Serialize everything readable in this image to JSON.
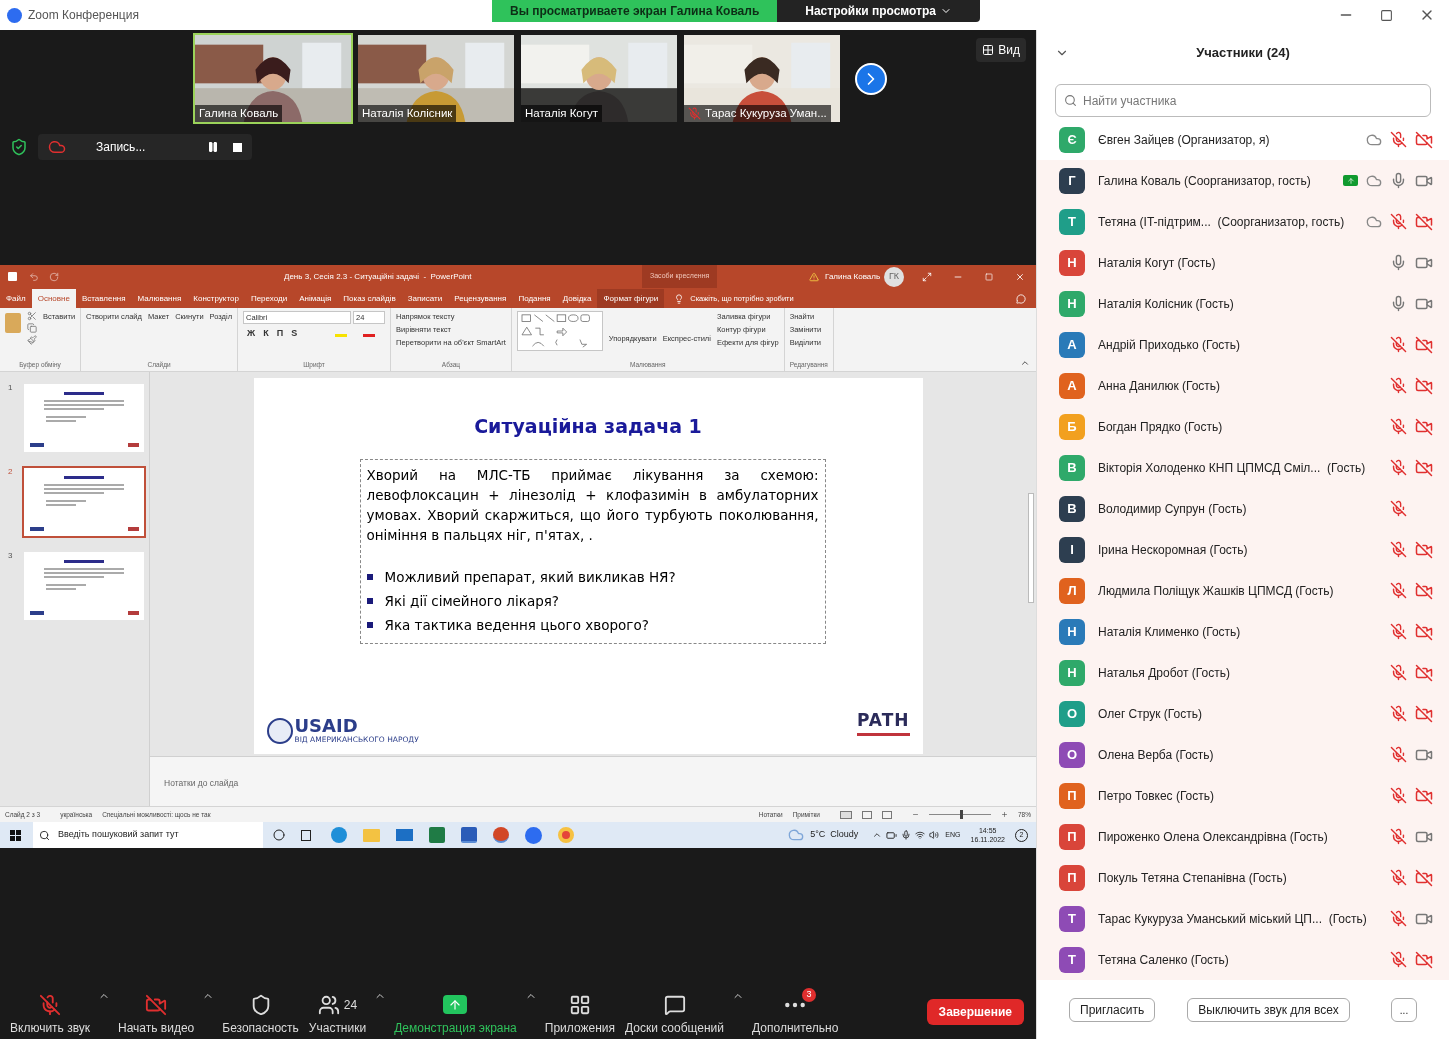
{
  "window": {
    "title": "Zoom Конференция"
  },
  "share_banner": {
    "text": "Вы просматриваете экран Галина Коваль",
    "menu": "Настройки просмотра"
  },
  "videos": [
    {
      "name": "Галина Коваль",
      "muted": false,
      "selected": true
    },
    {
      "name": "Наталія Колісник",
      "muted": false,
      "selected": false
    },
    {
      "name": "Наталія Когут",
      "muted": false,
      "selected": false
    },
    {
      "name": "Тарас Кукуруза Уман...",
      "muted": true,
      "selected": false
    }
  ],
  "view_button": "Вид",
  "recording": {
    "label": "Запись..."
  },
  "powerpoint": {
    "title": "День 3, Сесія 2.3 - Ситуаційні задачі  -  PowerPoint",
    "context_label": "Засоби креслення",
    "user": "Галина Коваль",
    "user_initials": "ГК",
    "tabs": [
      {
        "label": "Файл",
        "selected": false
      },
      {
        "label": "Основне",
        "selected": true
      },
      {
        "label": "Вставлення",
        "selected": false
      },
      {
        "label": "Малювання",
        "selected": false
      },
      {
        "label": "Конструктор",
        "selected": false
      },
      {
        "label": "Переходи",
        "selected": false
      },
      {
        "label": "Анімація",
        "selected": false
      },
      {
        "label": "Показ слайдів",
        "selected": false
      },
      {
        "label": "Записати",
        "selected": false
      },
      {
        "label": "Рецензування",
        "selected": false
      },
      {
        "label": "Подання",
        "selected": false
      },
      {
        "label": "Довідка",
        "selected": false
      },
      {
        "label": "Формат фігури",
        "selected": false
      }
    ],
    "tell_me": "Скажіть, що потрібно зробити",
    "ribbon": [
      {
        "label": "Буфер обміну",
        "items": [
          "Вставити"
        ]
      },
      {
        "label": "Слайди",
        "items": [
          "Створити слайд",
          "Макет",
          "Скинути",
          "Розділ"
        ]
      },
      {
        "label": "Шрифт",
        "font": "Calibri",
        "size": "24",
        "items": [
          "Ж",
          "К",
          "П",
          "S"
        ]
      },
      {
        "label": "Абзац",
        "items": [
          "Напрямок тексту",
          "Вирівняти текст",
          "Перетворити на об'єкт SmartArt"
        ]
      },
      {
        "label": "Малювання",
        "items": [
          "Упорядкувати",
          "Експрес-стилі",
          "Заливка фігури",
          "Контур фігури",
          "Ефекти для фігур"
        ]
      },
      {
        "label": "Редагування",
        "items": [
          "Знайти",
          "Замінити",
          "Виділити"
        ]
      }
    ],
    "thumbnails": [
      {
        "number": "1",
        "selected": false
      },
      {
        "number": "2",
        "selected": true
      },
      {
        "number": "3",
        "selected": false
      }
    ],
    "slide": {
      "title": "Ситуаційна задача 1",
      "paragraph": "Хворий на МЛС-ТБ приймає лікування за схемою: левофлоксацин + лінезолід + клофазимін в амбулаторних умовах.  Хворий скаржиться, що його турбують поколювання, оніміння в пальцях ніг, п'ятах, .",
      "bullets": [
        "Можливий препарат, який викликав НЯ?",
        "Які дії сімейного лікаря?",
        "Яка тактика ведення цього хворого?"
      ],
      "logo_left": "USAID",
      "logo_left_sub": "ВІД АМЕРИКАНСЬКОГО НАРОДУ",
      "logo_right": "PATH"
    },
    "notes_placeholder": "Нотатки до слайда",
    "status_bar": {
      "slide": "Слайд 2 з 3",
      "language": "українська",
      "accessibility": "Спеціальні можливості: щось не так",
      "notes": "Нотатки",
      "comments": "Примітки",
      "zoom": "78%",
      "level": 0.5
    }
  },
  "taskbar": {
    "search_placeholder": "Введіть пошуковий запит тут",
    "weather": "5°C  Cloudy",
    "language": "ENG",
    "time": "14:55",
    "date": "16.11.2022",
    "notifications": "2"
  },
  "toolbar": [
    {
      "kind": "mic",
      "label": "Включить звук"
    },
    {
      "kind": "video",
      "label": "Начать видео"
    },
    {
      "kind": "security",
      "label": "Безопасность"
    },
    {
      "kind": "participants",
      "label": "Участники",
      "count": "24"
    },
    {
      "kind": "share",
      "label": "Демонстрация экрана"
    },
    {
      "kind": "apps",
      "label": "Приложения"
    },
    {
      "kind": "whiteboard",
      "label": "Доски сообщений"
    },
    {
      "kind": "more",
      "label": "Дополнительно",
      "badge": "3"
    }
  ],
  "end_button": "Завершение",
  "participants_panel": {
    "title": "Участники (24)",
    "search_placeholder": "Найти участника",
    "participants": [
      {
        "initial": "Є",
        "name": "Євген Зайцев (Организатор, я)",
        "color": "#2fa96a",
        "highlighted": false,
        "sharing": false,
        "recording": true,
        "mic_muted": true,
        "has_camera": true,
        "video_off": true
      },
      {
        "initial": "Г",
        "name": "Галина Коваль (Соорганизатор, гость)",
        "color": "#2d3e50",
        "highlighted": true,
        "sharing": true,
        "recording": true,
        "mic_muted": false,
        "has_camera": true,
        "video_off": false
      },
      {
        "initial": "Т",
        "name": "Тетяна (IT-підтрим...  (Соорганизатор, гость)",
        "color": "#1f9e89",
        "highlighted": true,
        "sharing": false,
        "recording": true,
        "mic_muted": true,
        "has_camera": true,
        "video_off": true
      },
      {
        "initial": "Н",
        "name": "Наталія Когут (Гость)",
        "color": "#d9453a",
        "highlighted": true,
        "sharing": false,
        "recording": false,
        "mic_muted": false,
        "has_camera": true,
        "video_off": false
      },
      {
        "initial": "Н",
        "name": "Наталія Колісник (Гость)",
        "color": "#2fa96a",
        "highlighted": true,
        "sharing": false,
        "recording": false,
        "mic_muted": false,
        "has_camera": true,
        "video_off": false
      },
      {
        "initial": "А",
        "name": "Андрій Приходько (Гость)",
        "color": "#2a7ab8",
        "highlighted": true,
        "sharing": false,
        "recording": false,
        "mic_muted": true,
        "has_camera": true,
        "video_off": true
      },
      {
        "initial": "А",
        "name": "Анна Данилюк (Гость)",
        "color": "#e0621e",
        "highlighted": true,
        "sharing": false,
        "recording": false,
        "mic_muted": true,
        "has_camera": true,
        "video_off": true
      },
      {
        "initial": "Б",
        "name": "Богдан Прядко (Гость)",
        "color": "#f2a01f",
        "highlighted": true,
        "sharing": false,
        "recording": false,
        "mic_muted": true,
        "has_camera": true,
        "video_off": true
      },
      {
        "initial": "В",
        "name": "Вікторія Холоденко КНП ЦПМСД Сміл...  (Гость)",
        "color": "#2fa96a",
        "highlighted": true,
        "sharing": false,
        "recording": false,
        "mic_muted": true,
        "has_camera": true,
        "video_off": true
      },
      {
        "initial": "В",
        "name": "Володимир Супрун (Гость)",
        "color": "#2d3e50",
        "highlighted": true,
        "sharing": false,
        "recording": false,
        "mic_muted": true,
        "has_camera": false,
        "video_off": true
      },
      {
        "initial": "І",
        "name": "Ірина Нескоромная (Гость)",
        "color": "#2d3e50",
        "highlighted": true,
        "sharing": false,
        "recording": false,
        "mic_muted": true,
        "has_camera": true,
        "video_off": true
      },
      {
        "initial": "Л",
        "name": "Людмила Поліщук Жашків ЦПМСД (Гость)",
        "color": "#e0621e",
        "highlighted": true,
        "sharing": false,
        "recording": false,
        "mic_muted": true,
        "has_camera": true,
        "video_off": true
      },
      {
        "initial": "Н",
        "name": "Наталія Клименко (Гость)",
        "color": "#2a7ab8",
        "highlighted": true,
        "sharing": false,
        "recording": false,
        "mic_muted": true,
        "has_camera": true,
        "video_off": true
      },
      {
        "initial": "Н",
        "name": "Наталья Дробот (Гость)",
        "color": "#2fa96a",
        "highlighted": true,
        "sharing": false,
        "recording": false,
        "mic_muted": true,
        "has_camera": true,
        "video_off": true
      },
      {
        "initial": "О",
        "name": "Олег Струк (Гость)",
        "color": "#1f9e89",
        "highlighted": true,
        "sharing": false,
        "recording": false,
        "mic_muted": true,
        "has_camera": true,
        "video_off": true
      },
      {
        "initial": "О",
        "name": "Олена Верба (Гость)",
        "color": "#8e4bb5",
        "highlighted": true,
        "sharing": false,
        "recording": false,
        "mic_muted": true,
        "has_camera": true,
        "video_off": false
      },
      {
        "initial": "П",
        "name": "Петро Товкес (Гость)",
        "color": "#e0621e",
        "highlighted": true,
        "sharing": false,
        "recording": false,
        "mic_muted": true,
        "has_camera": true,
        "video_off": true
      },
      {
        "initial": "П",
        "name": "Пироженко Олена Олександрівна (Гость)",
        "color": "#d9453a",
        "highlighted": true,
        "sharing": false,
        "recording": false,
        "mic_muted": true,
        "has_camera": true,
        "video_off": false
      },
      {
        "initial": "П",
        "name": "Покуль Тетяна Степанівна (Гость)",
        "color": "#d9453a",
        "highlighted": true,
        "sharing": false,
        "recording": false,
        "mic_muted": true,
        "has_camera": true,
        "video_off": true
      },
      {
        "initial": "Т",
        "name": "Тарас Кукуруза Уманський міський ЦП...  (Гость)",
        "color": "#8e4bb5",
        "highlighted": true,
        "sharing": false,
        "recording": false,
        "mic_muted": true,
        "has_camera": true,
        "video_off": false
      },
      {
        "initial": "Т",
        "name": "Тетяна Саленко (Гость)",
        "color": "#8e4bb5",
        "highlighted": true,
        "sharing": false,
        "recording": false,
        "mic_muted": true,
        "has_camera": true,
        "video_off": true
      }
    ],
    "buttons": [
      "Пригласить",
      "Выключить звук для всех",
      "..."
    ]
  }
}
